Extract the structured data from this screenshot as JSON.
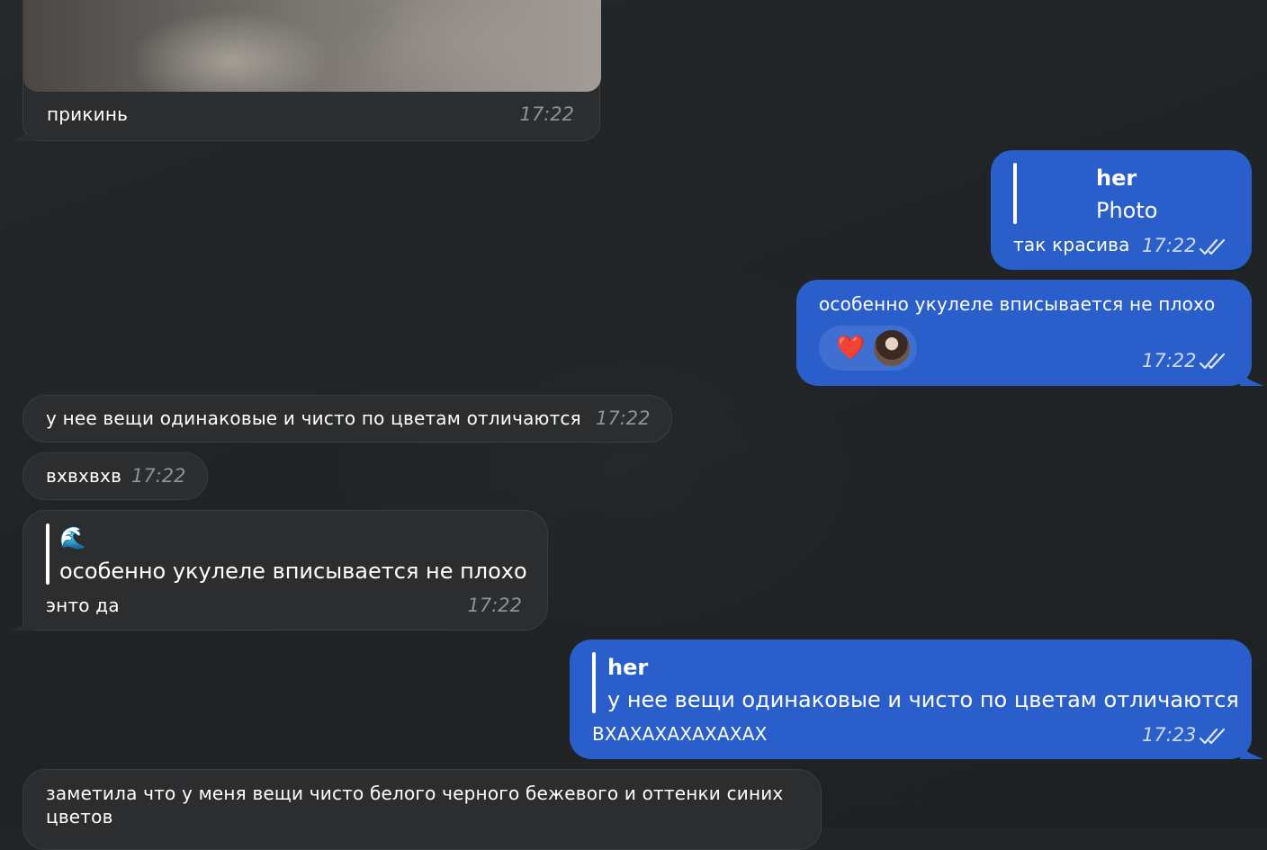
{
  "messages": [
    {
      "id": "m1",
      "direction": "incoming",
      "has_photo": true,
      "text": "прикинь",
      "time": "17:22"
    },
    {
      "id": "m2",
      "direction": "outgoing",
      "reply": {
        "name": "her",
        "text": "Photo"
      },
      "text": "так красива",
      "time": "17:22",
      "status": "read"
    },
    {
      "id": "m3",
      "direction": "outgoing",
      "text": "особенно укулеле вписывается не плохо",
      "reaction": {
        "emoji": "❤️",
        "icon": "heart-icon"
      },
      "time": "17:22",
      "status": "read"
    },
    {
      "id": "m4",
      "direction": "incoming",
      "text": "у нее вещи одинаковые и чисто по цветам отличаются",
      "time": "17:22"
    },
    {
      "id": "m5",
      "direction": "incoming",
      "text": "вхвхвхв",
      "time": "17:22"
    },
    {
      "id": "m6",
      "direction": "incoming",
      "reply": {
        "name": "🌊",
        "text": "особенно укулеле вписывается не плохо"
      },
      "text": "энто да",
      "time": "17:22"
    },
    {
      "id": "m7",
      "direction": "outgoing",
      "reply": {
        "name": "her",
        "text": "у нее вещи одинаковые и чисто по цветам отличаются"
      },
      "text": "ВХАХАХАХАХАХАХ",
      "time": "17:23",
      "status": "read"
    },
    {
      "id": "m8",
      "direction": "incoming",
      "text_line1": "заметила что у меня вещи чисто белого черного бежевого и оттенки синих",
      "text_line2": "цветов"
    }
  ],
  "colors": {
    "background": "#222528",
    "incoming_bubble": "#2b2d2f",
    "outgoing_bubble": "#2a5fcb",
    "incoming_time": "#8e9296",
    "outgoing_time": "#cfdaf5"
  }
}
